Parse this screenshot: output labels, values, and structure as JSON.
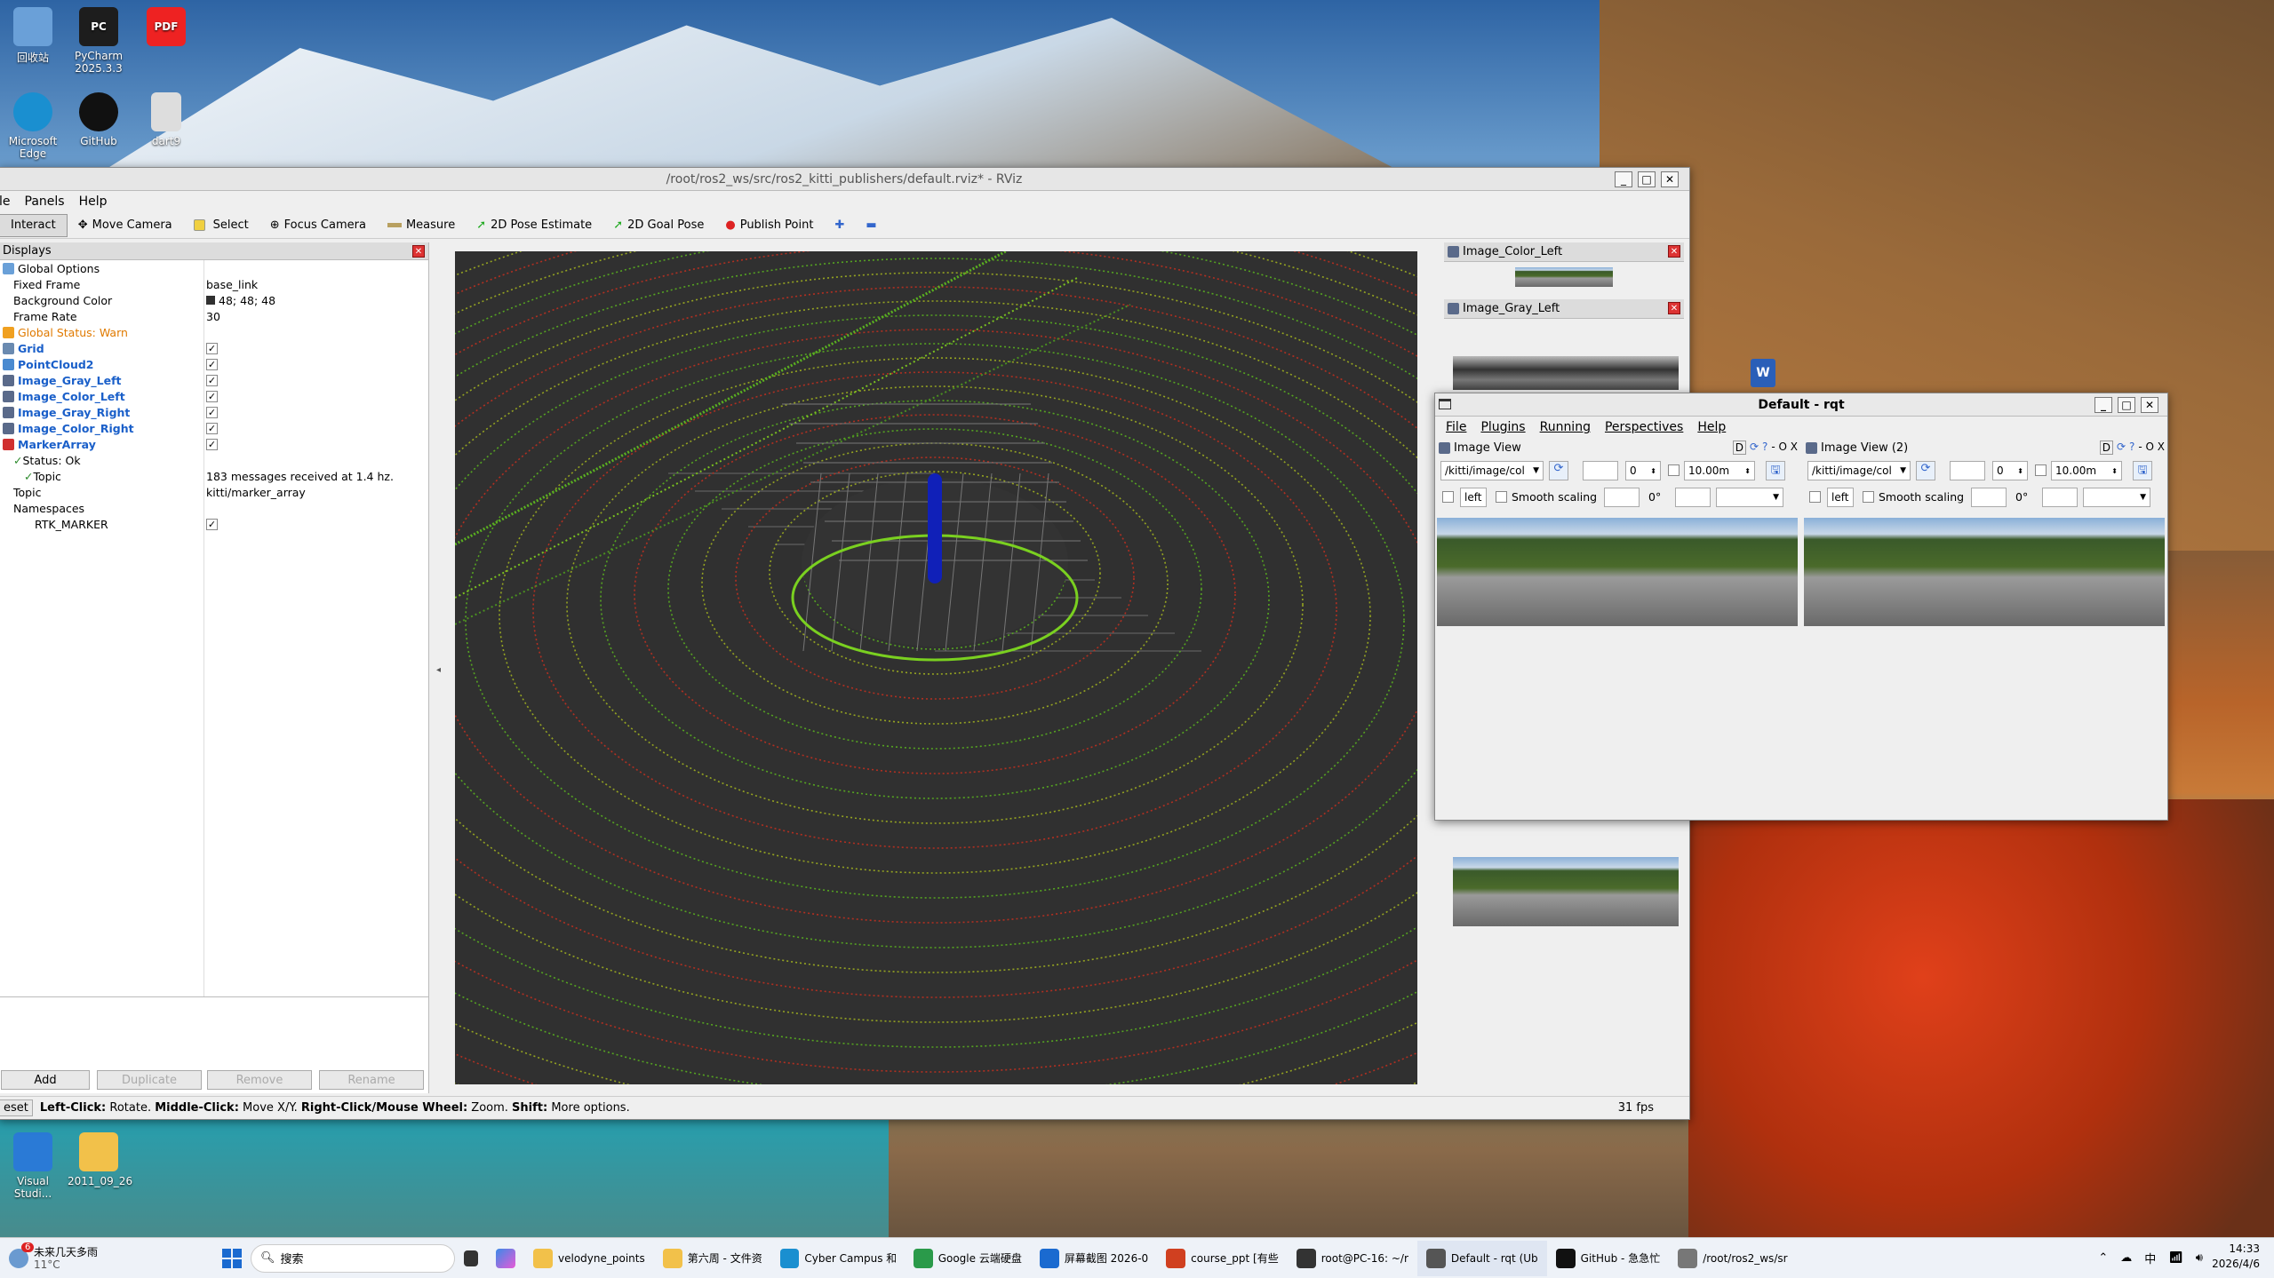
{
  "desktop": {
    "icons_top": [
      {
        "label": "回收站",
        "color": "#6aa0d8"
      },
      {
        "label": "PyCharm 2025.3.3",
        "color": "#1d1d1d"
      },
      {
        "label": "",
        "color": "#e22"
      }
    ],
    "icons_row2": [
      {
        "label": "Microsoft Edge",
        "color": "#1a8fd0"
      },
      {
        "label": "GitHub",
        "color": "#111"
      },
      {
        "label": "dart9",
        "color": "#ddd"
      }
    ],
    "icons_bottom": [
      {
        "label": "Visual Studi...",
        "color": "#2a7ad6"
      },
      {
        "label": "2011_09_26",
        "color": "#f2c14a"
      }
    ],
    "pdf_badge": "PDF"
  },
  "rviz": {
    "title": "/root/ros2_ws/src/ros2_kitti_publishers/default.rviz* - RViz",
    "menu": [
      "le",
      "Panels",
      "Help"
    ],
    "toolbar": [
      "Interact",
      "Move Camera",
      "Select",
      "Focus Camera",
      "Measure",
      "2D Pose Estimate",
      "2D Goal Pose",
      "Publish Point"
    ],
    "displays_title": "Displays",
    "tree": [
      {
        "label": "Global Options",
        "value": "",
        "cls": "",
        "indent": 0,
        "icon": "#6aa0d8",
        "chk": false
      },
      {
        "label": "Fixed Frame",
        "value": "base_link",
        "cls": "",
        "indent": 1,
        "chk": false
      },
      {
        "label": "Background Color",
        "value": "48; 48; 48",
        "cls": "",
        "indent": 1,
        "swatch": "#303030",
        "chk": false
      },
      {
        "label": "Frame Rate",
        "value": "30",
        "cls": "",
        "indent": 1,
        "chk": false
      },
      {
        "label": "Global Status: Warn",
        "value": "",
        "cls": "orange",
        "indent": 0,
        "icon": "#f0a020",
        "chk": false
      },
      {
        "label": "Grid",
        "value": "",
        "cls": "blue",
        "indent": 0,
        "icon": "#6a8ab0",
        "chk": true
      },
      {
        "label": "PointCloud2",
        "value": "",
        "cls": "blue",
        "indent": 0,
        "icon": "#4a8ad0",
        "chk": true
      },
      {
        "label": "Image_Gray_Left",
        "value": "",
        "cls": "blue",
        "indent": 0,
        "icon": "#5a6a8a",
        "chk": true
      },
      {
        "label": "Image_Color_Left",
        "value": "",
        "cls": "blue",
        "indent": 0,
        "icon": "#5a6a8a",
        "chk": true
      },
      {
        "label": "Image_Gray_Right",
        "value": "",
        "cls": "blue",
        "indent": 0,
        "icon": "#5a6a8a",
        "chk": true
      },
      {
        "label": "Image_Color_Right",
        "value": "",
        "cls": "blue",
        "indent": 0,
        "icon": "#5a6a8a",
        "chk": true
      },
      {
        "label": "MarkerArray",
        "value": "",
        "cls": "blue",
        "indent": 0,
        "icon": "#d03030",
        "chk": true
      },
      {
        "label": "Status: Ok",
        "value": "",
        "cls": "",
        "indent": 1,
        "tick": true,
        "chk": false
      },
      {
        "label": "Topic",
        "value": "183 messages received at 1.4 hz.",
        "cls": "",
        "indent": 2,
        "tick": true,
        "chk": false
      },
      {
        "label": "Topic",
        "value": "kitti/marker_array",
        "cls": "",
        "indent": 1,
        "chk": false
      },
      {
        "label": "Namespaces",
        "value": "",
        "cls": "",
        "indent": 1,
        "chk": false
      },
      {
        "label": "RTK_MARKER",
        "value": "",
        "cls": "",
        "indent": 3,
        "chk": true
      }
    ],
    "buttons": {
      "add": "Add",
      "duplicate": "Duplicate",
      "remove": "Remove",
      "rename": "Rename"
    },
    "status_reset": "eset",
    "status_help": [
      {
        "b": "Left-Click:",
        "t": " Rotate. "
      },
      {
        "b": "Middle-Click:",
        "t": " Move X/Y. "
      },
      {
        "b": "Right-Click/Mouse Wheel:",
        "t": " Zoom. "
      },
      {
        "b": "Shift:",
        "t": " More options."
      }
    ],
    "fps": "31 fps",
    "image_panels": {
      "color_left": "Image_Color_Left",
      "gray_left": "Image_Gray_Left"
    }
  },
  "rqt": {
    "title": "Default - rqt",
    "menu": [
      "File",
      "Plugins",
      "Running",
      "Perspectives",
      "Help"
    ],
    "views": [
      {
        "title": "Image View",
        "topic": "/kitti/image/col",
        "num": "0",
        "max": "10.00m",
        "chk_left": "left",
        "smooth": "Smooth scaling",
        "deg": "0°",
        "dopt": "D",
        "close": "- O X"
      },
      {
        "title": "Image View (2)",
        "topic": "/kitti/image/col",
        "num": "0",
        "max": "10.00m",
        "chk_left": "left",
        "smooth": "Smooth scaling",
        "deg": "0°",
        "dopt": "D",
        "close": "- O X"
      }
    ]
  },
  "taskbar": {
    "weather_temp": "11°C",
    "weather_text": "未来几天多雨",
    "weather_badge": "6",
    "search": "搜索",
    "items": [
      {
        "label": "velodyne_points",
        "color": "#f2c14a"
      },
      {
        "label": "第六周 - 文件资",
        "color": "#f2c14a"
      },
      {
        "label": "Cyber Campus 和",
        "color": "#1a8fd0"
      },
      {
        "label": "Google 云端硬盘",
        "color": "#2a9a4a"
      },
      {
        "label": "屏幕截图 2026-0",
        "color": "#1a6ad0"
      },
      {
        "label": "course_ppt [有些",
        "color": "#d04020"
      },
      {
        "label": "root@PC-16: ~/r",
        "color": "#333"
      },
      {
        "label": "Default - rqt (Ub",
        "color": "#555"
      },
      {
        "label": "GitHub - 急急忙",
        "color": "#111"
      },
      {
        "label": "/root/ros2_ws/sr",
        "color": "#777"
      }
    ],
    "ime": "中",
    "time": "14:33",
    "date": "2026/4/6"
  }
}
